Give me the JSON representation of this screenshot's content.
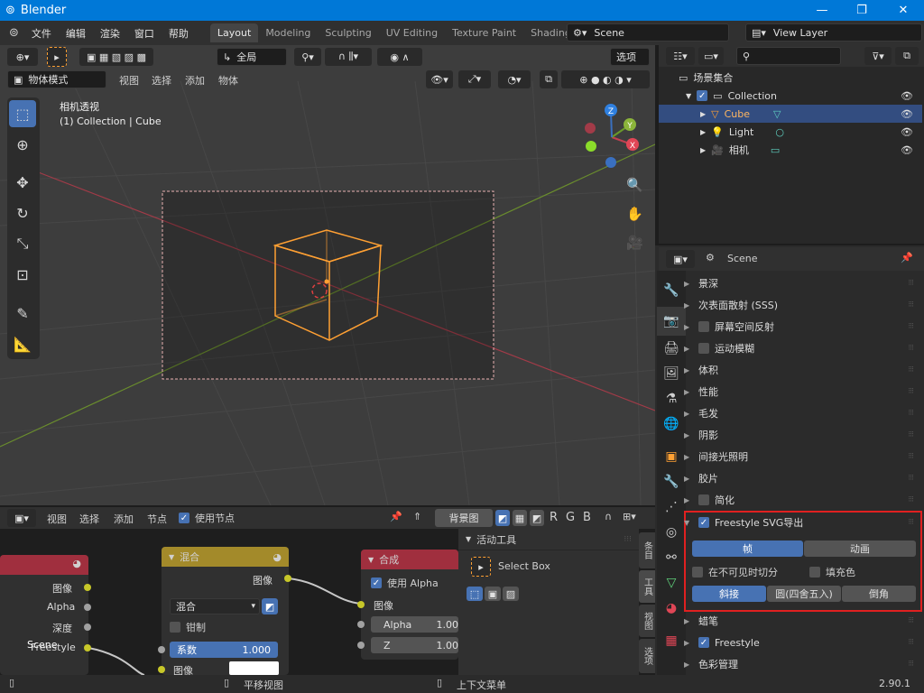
{
  "window": {
    "title": "Blender",
    "min": "—",
    "max": "❐",
    "close": "✕"
  },
  "menu": [
    "文件",
    "编辑",
    "渲染",
    "窗口",
    "帮助"
  ],
  "workspaces": [
    "Layout",
    "Modeling",
    "Sculpting",
    "UV Editing",
    "Texture Paint",
    "Shading"
  ],
  "scene_field": "Scene",
  "view_layer_field": "View Layer",
  "viewport": {
    "transform_space": "全局",
    "options": "选项",
    "mode": "物体模式",
    "menus": [
      "视图",
      "选择",
      "添加",
      "物体"
    ],
    "overlay_title": "相机透视",
    "overlay_sub": "(1) Collection | Cube",
    "gizmo": {
      "x": "X",
      "y": "Y",
      "z": "Z"
    }
  },
  "outliner": {
    "root": "场景集合",
    "items": [
      {
        "label": "Collection"
      },
      {
        "label": "Cube"
      },
      {
        "label": "Light"
      },
      {
        "label": "相机"
      }
    ]
  },
  "properties": {
    "context": "Scene",
    "panels": [
      {
        "label": "景深",
        "check": null
      },
      {
        "label": "次表面散射 (SSS)",
        "check": null
      },
      {
        "label": "屏幕空间反射",
        "check": false
      },
      {
        "label": "运动模糊",
        "check": false
      },
      {
        "label": "体积",
        "check": null
      },
      {
        "label": "性能",
        "check": null
      },
      {
        "label": "毛发",
        "check": null
      },
      {
        "label": "阴影",
        "check": null
      },
      {
        "label": "间接光照明",
        "check": null
      },
      {
        "label": "胶片",
        "check": null
      },
      {
        "label": "简化",
        "check": false
      }
    ],
    "svg_panel": {
      "title": "Freestyle SVG导出",
      "mode_frame": "帧",
      "mode_anim": "动画",
      "split_invisible": "在不可见时切分",
      "fill": "填充色",
      "join_miter": "斜接",
      "join_round": "圆(四舍五入)",
      "join_bevel": "倒角"
    },
    "after": [
      {
        "label": "蜡笔",
        "check": null
      },
      {
        "label": "Freestyle",
        "check": true
      },
      {
        "label": "色彩管理",
        "check": null
      }
    ]
  },
  "node_editor": {
    "menus": [
      "视图",
      "选择",
      "添加",
      "节点"
    ],
    "use_nodes": "使用节点",
    "backdrop": "背景图",
    "channels": [
      "R",
      "G",
      "B"
    ],
    "render_layers_node": {
      "outputs": [
        "图像",
        "Alpha",
        "深度",
        "Freestyle"
      ],
      "overlay_label": "Scene"
    },
    "mix_node": {
      "title": "混合",
      "out": "图像",
      "blend": "混合",
      "clamp": "钳制",
      "factor_label": "系数",
      "factor": "1.000",
      "img": "图像"
    },
    "composite_node": {
      "title": "合成",
      "use_alpha": "使用 Alpha",
      "img": "图像",
      "alpha_label": "Alpha",
      "alpha_val": "1.00",
      "z_label": "Z",
      "z_val": "1.00"
    },
    "side_panel": {
      "title": "活动工具",
      "tool": "Select Box"
    },
    "vtabs": [
      "条目",
      "工具",
      "视图",
      "选项"
    ]
  },
  "statusbar": {
    "pan": "平移视图",
    "ctx": "上下文菜单",
    "version": "2.90.1"
  },
  "colors": {
    "accent": "#4772b3",
    "highlight_border": "#e02020",
    "cube": "#ffa033"
  }
}
